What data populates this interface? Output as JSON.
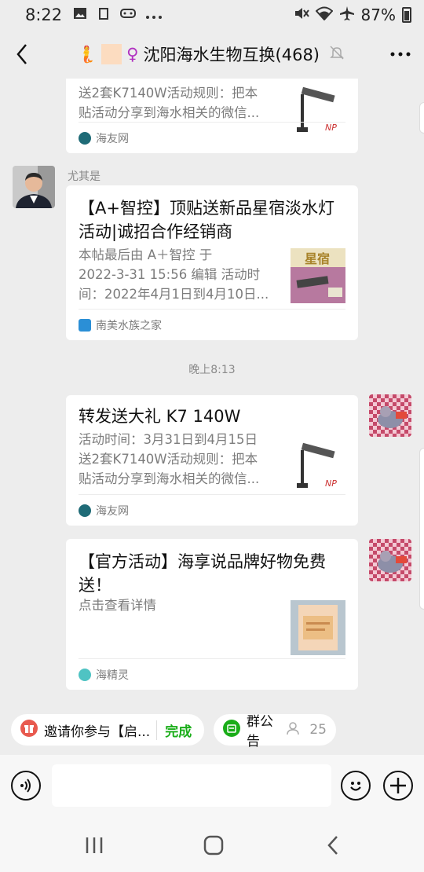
{
  "status": {
    "time": "8:22",
    "battery": "87%"
  },
  "header": {
    "mermaid_emoji": "🧜",
    "female_emoji": "♀",
    "title": "沈阳海水生物互换(468)"
  },
  "messages": {
    "m1": {
      "desc": "送2套K7140W活动规则：把本\n贴活动分享到海水相关的微信...",
      "source": "海友网"
    },
    "m2": {
      "sender": "尤其是",
      "title": "【A+智控】顶贴送新品星宿淡水灯活动|诚招合作经销商",
      "desc": "本帖最后由 A＋智控 于\n2022-3-31 15:56 编辑 活动时\n间：2022年4月1日到4月10日...",
      "thumb_text": "星宿",
      "source": "南美水族之家"
    },
    "timestamp": "晚上8:13",
    "m3": {
      "title": "转发送大礼 K7 140W",
      "desc": "活动时间：3月31日到4月15日\n送2套K7140W活动规则：把本\n贴活动分享到海水相关的微信...",
      "source": "海友网"
    },
    "m4": {
      "title": "【官方活动】海享说品牌好物免费送！",
      "desc": "点击查看详情",
      "source": "海精灵"
    }
  },
  "chips": {
    "invite": {
      "label": "邀请你参与【启...",
      "done": "完成"
    },
    "notice": {
      "label": "群公告",
      "count": "25"
    }
  },
  "colors": {
    "green": "#1aad19",
    "bg": "#ededed",
    "bubble": "#ffffff"
  }
}
